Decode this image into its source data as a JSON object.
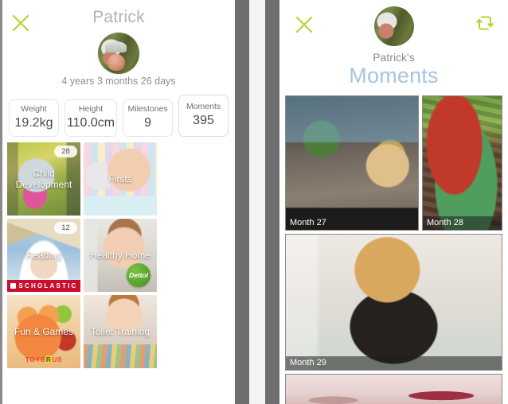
{
  "left_panel": {
    "close_icon": "close-x-icon",
    "title": "Patrick",
    "avatar_alt": "child-avatar",
    "age": "4 years 3 months 26 days",
    "stats": [
      {
        "label": "Weight",
        "value": "19.2kg"
      },
      {
        "label": "Height",
        "value": "110.0cm"
      },
      {
        "label": "Milestones",
        "value": "9"
      },
      {
        "label": "Moments",
        "value": "395"
      }
    ],
    "tiles": [
      {
        "label": "Child Development",
        "badge": "28",
        "brand": ""
      },
      {
        "label": "Firsts",
        "badge": "",
        "brand": ""
      },
      {
        "label": "Reading",
        "badge": "12",
        "brand": "SCHOLASTIC"
      },
      {
        "label": "Healthy Home",
        "badge": "",
        "brand": "Dettol"
      },
      {
        "label": "Fun & Games",
        "badge": "",
        "brand": "TOYS R US"
      },
      {
        "label": "Toilet Training",
        "badge": "",
        "brand": ""
      }
    ]
  },
  "right_panel": {
    "close_icon": "close-x-icon",
    "sync_icon": "refresh-sync-icon",
    "avatar_alt": "child-avatar",
    "subtitle": "Patrick's",
    "heading": "Moments",
    "photos": [
      {
        "label": "Month 27"
      },
      {
        "label": "Month 28"
      },
      {
        "label": "Month 29"
      },
      {
        "label": ""
      }
    ]
  },
  "colors": {
    "accent_green": "#b5d334",
    "heading_blue": "#a8c4e0",
    "scholastic_red": "#c8102e",
    "dettol_green": "#3f8f1f",
    "frame_gray": "#6e6e6e"
  }
}
